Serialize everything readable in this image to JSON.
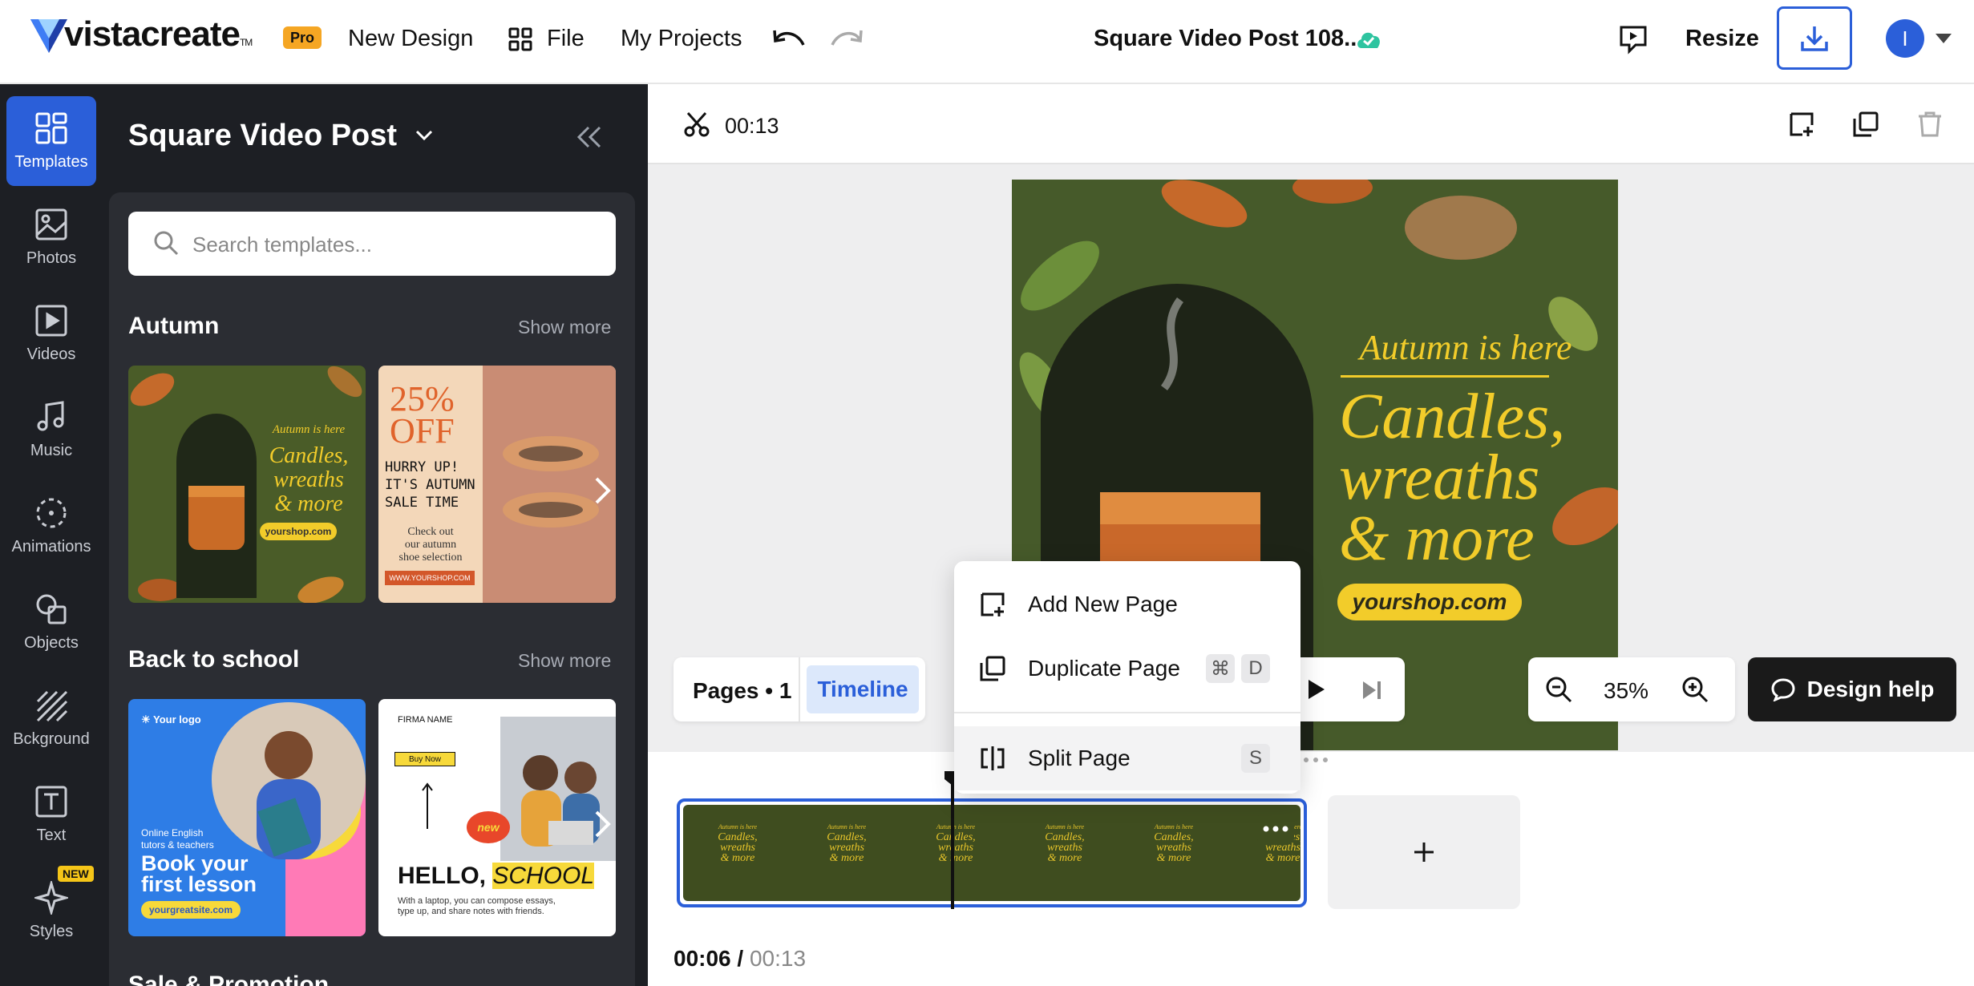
{
  "header": {
    "logo": "vistacreate",
    "logo_tm": "TM",
    "pro_badge": "Pro",
    "new_design": "New Design",
    "file": "File",
    "my_projects": "My Projects",
    "doc_title": "Square Video Post 108...",
    "resize": "Resize",
    "avatar_initial": "I",
    "accent": "#2b5fd9"
  },
  "rail": {
    "items": [
      {
        "label": "Templates",
        "icon": "templates-icon"
      },
      {
        "label": "Photos",
        "icon": "photos-icon"
      },
      {
        "label": "Videos",
        "icon": "videos-icon"
      },
      {
        "label": "Music",
        "icon": "music-icon"
      },
      {
        "label": "Animations",
        "icon": "animations-icon"
      },
      {
        "label": "Objects",
        "icon": "objects-icon"
      },
      {
        "label": "Bckground",
        "icon": "background-icon"
      },
      {
        "label": "Text",
        "icon": "text-icon"
      },
      {
        "label": "Styles",
        "icon": "styles-icon"
      }
    ],
    "new_badge": "NEW"
  },
  "panel": {
    "title": "Square Video Post",
    "search_placeholder": "Search templates...",
    "sections": [
      {
        "title": "Autumn",
        "show_more": "Show more"
      },
      {
        "title": "Back to school",
        "show_more": "Show more"
      },
      {
        "title": "Sale & Promotion",
        "show_more": ""
      }
    ],
    "autumn_thumb1": {
      "line1": "Autumn is here",
      "line2": "Candles,",
      "line3": "wreaths",
      "line4": "& more",
      "url": "yourshop.com"
    },
    "autumn_thumb2": {
      "pct": "25%",
      "off": "OFF",
      "hurry1": "HURRY UP!",
      "hurry2": "IT'S AUTUMN",
      "hurry3": "SALE TIME",
      "check1": "Check out",
      "check2": "our autumn",
      "check3": "shoe selection",
      "url": "WWW.YOURSHOP.COM"
    },
    "school_thumb1": {
      "logo": "Your logo",
      "l1": "Online English",
      "l2": "tutors & teachers",
      "big1": "Book your",
      "big2": "first lesson",
      "url": "yourgreatsite.com"
    },
    "school_thumb2": {
      "firm": "FIRMA NAME",
      "buy": "Buy Now",
      "new": "new",
      "hello": "HELLO,",
      "school": "SCHOOL",
      "sub1": "With a laptop, you can compose essays,",
      "sub2": "type up, and share notes with friends."
    }
  },
  "editor": {
    "duration": "00:13",
    "canvas": {
      "autumn": "Autumn is here",
      "line1": "Candles,",
      "line2": "wreaths",
      "line3": "& more",
      "url": "yourshop.com"
    },
    "pages_label": "Pages • 1",
    "timeline_tab": "Timeline",
    "zoom": "35%",
    "design_help": "Design help",
    "current_time": "00:06",
    "separator": "/",
    "total_time": "00:13"
  },
  "context_menu": {
    "add_page": "Add New Page",
    "duplicate_page": "Duplicate Page",
    "dup_key1": "⌘",
    "dup_key2": "D",
    "split_page": "Split Page",
    "split_key": "S"
  },
  "timeline_clip": {
    "mini_line1": "Autumn is here",
    "mini_line2": "Candles,",
    "mini_line3": "wreaths",
    "mini_line4": "& more"
  }
}
